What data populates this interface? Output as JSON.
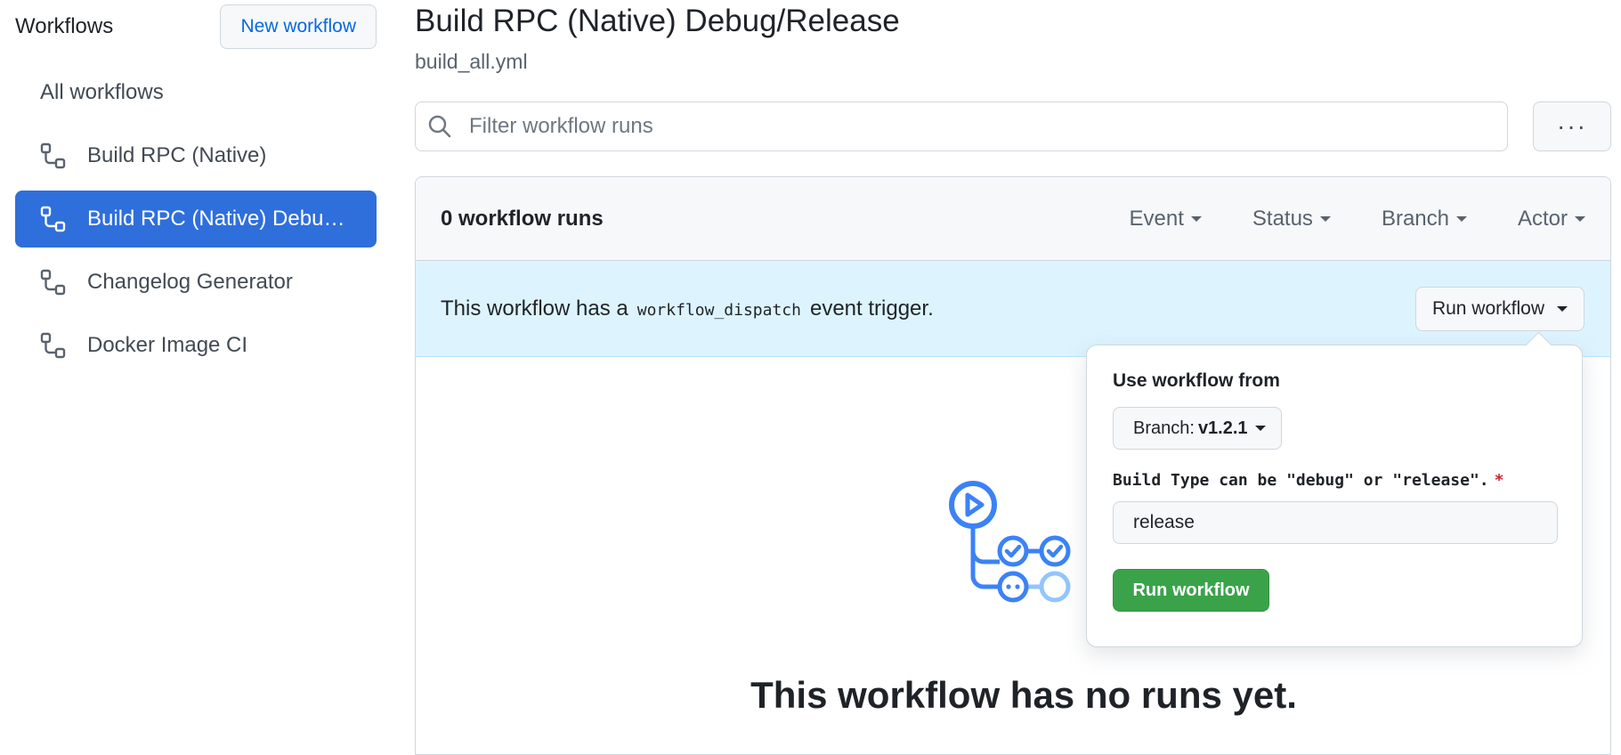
{
  "sidebar": {
    "title": "Workflows",
    "new_workflow_label": "New workflow",
    "all_workflows_label": "All workflows",
    "items": [
      {
        "label": "Build RPC (Native)",
        "icon": "workflow-icon",
        "active": false
      },
      {
        "label": "Build RPC (Native) Debug/Release",
        "icon": "workflow-icon",
        "active": true
      },
      {
        "label": "Changelog Generator",
        "icon": "workflow-icon",
        "active": false
      },
      {
        "label": "Docker Image CI",
        "icon": "workflow-icon",
        "active": false
      }
    ]
  },
  "header": {
    "title": "Build RPC (Native) Debug/Release",
    "filename": "build_all.yml"
  },
  "search": {
    "placeholder": "Filter workflow runs",
    "value": ""
  },
  "more_button_label": "···",
  "runs": {
    "count_label": "0 workflow runs",
    "filters": [
      "Event",
      "Status",
      "Branch",
      "Actor"
    ]
  },
  "dispatch": {
    "text_before": "This workflow has a",
    "code": "workflow_dispatch",
    "text_after": "event trigger.",
    "run_button_label": "Run workflow"
  },
  "popover": {
    "use_from_label": "Use workflow from",
    "branch_prefix": "Branch:",
    "branch_value": "v1.2.1",
    "input_label": "Build Type can be \"debug\" or \"release\".",
    "required_mark": "*",
    "input_value": "release",
    "submit_label": "Run workflow"
  },
  "empty_state": {
    "title": "This workflow has no runs yet."
  },
  "colors": {
    "accent_blue": "#2f6fdb",
    "link_blue": "#0969da",
    "banner_bg": "#ddf4ff",
    "success_green": "#3aa34a",
    "danger_red": "#cf222e"
  }
}
